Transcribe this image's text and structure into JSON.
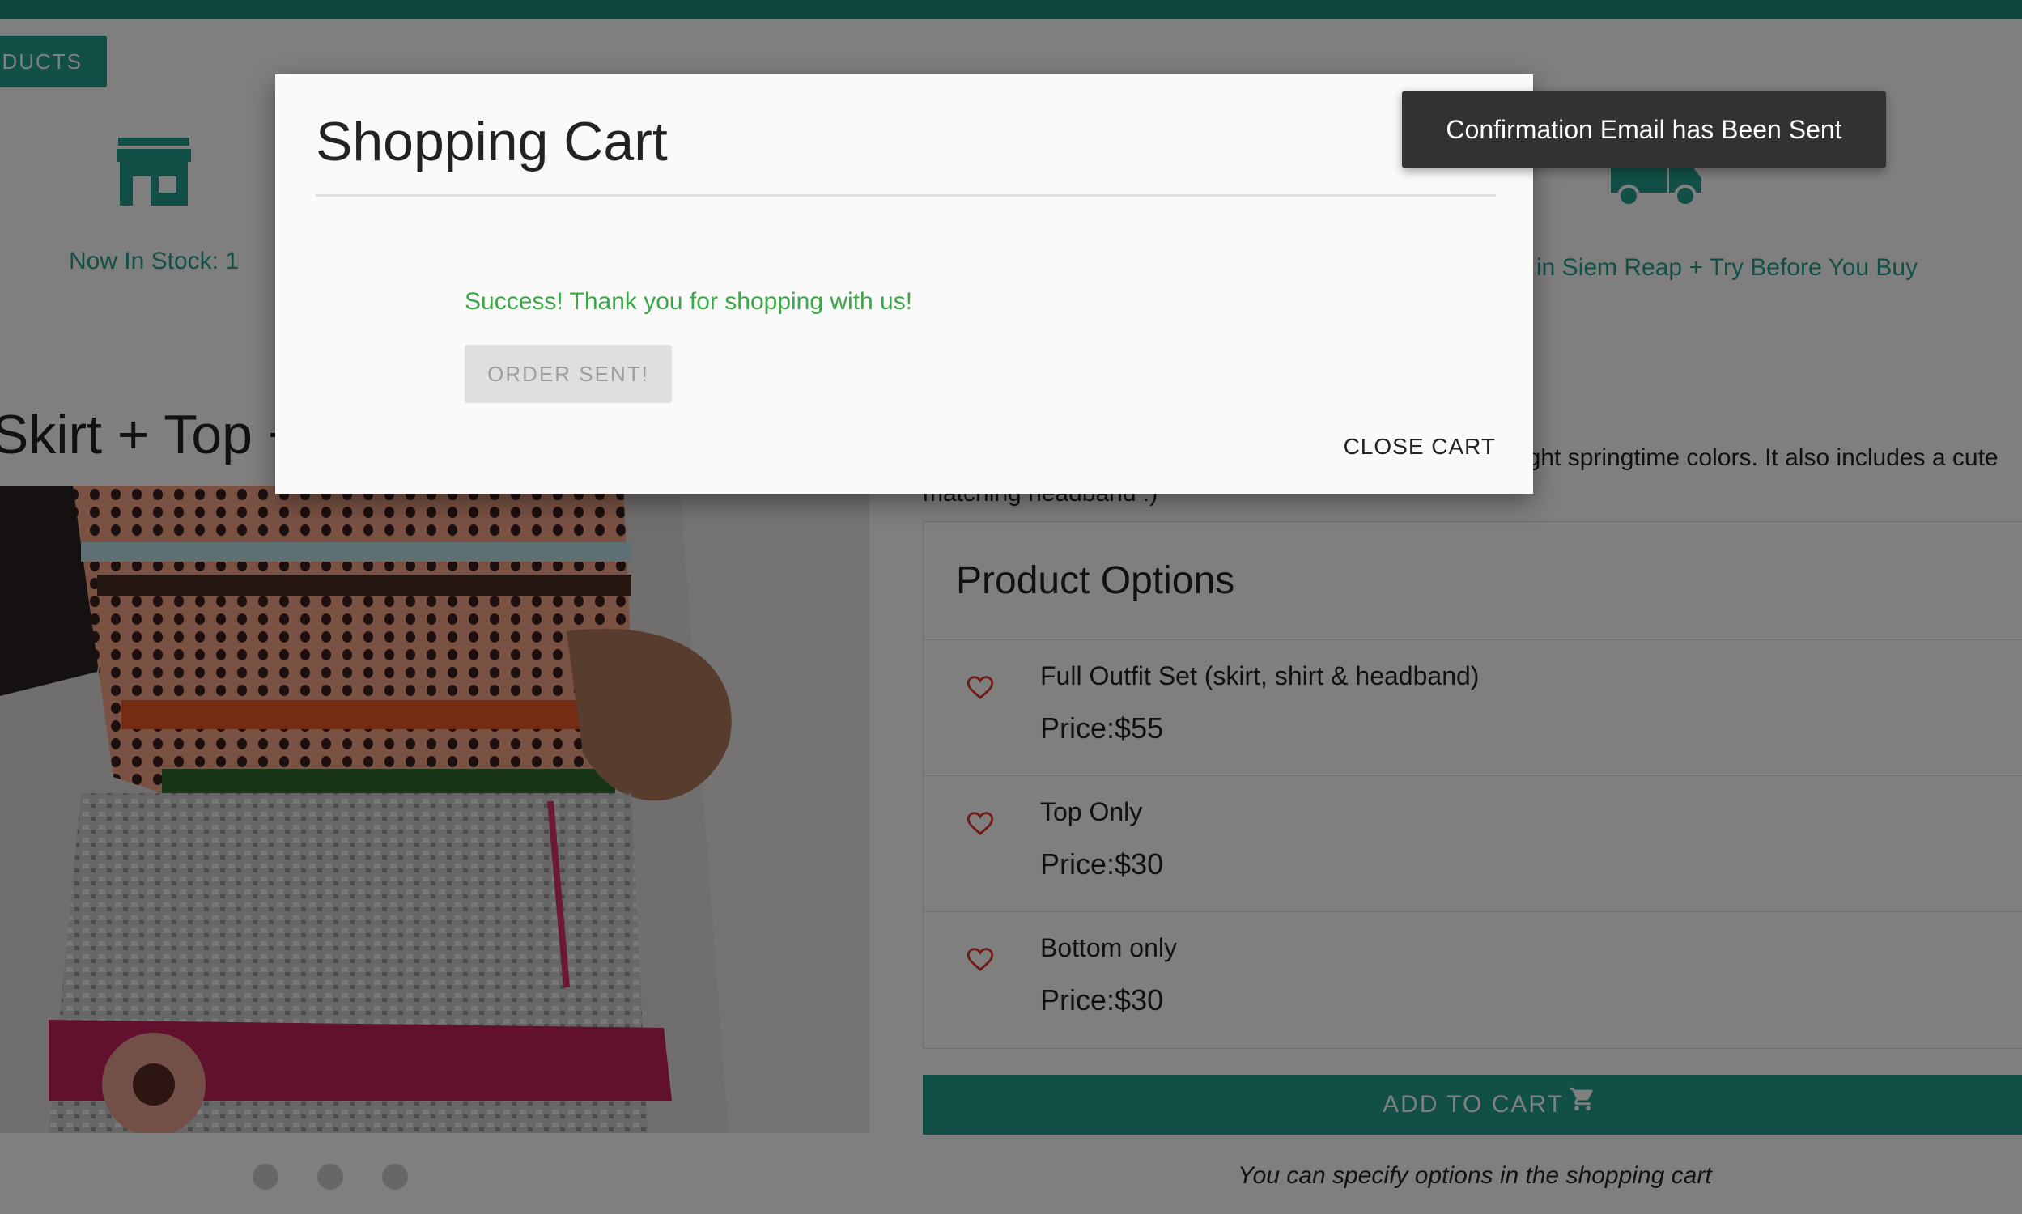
{
  "nav": {
    "products_label": "ODUCTS"
  },
  "features": {
    "stock_text": "Now In Stock: 1",
    "delivery_text": "in Siem Reap + Try Before You Buy"
  },
  "product": {
    "title": "Skirt + Top +",
    "description_line1": "ight springtime colors. It also includes a cute",
    "description_line2": "matching headband :)"
  },
  "options": {
    "title": "Product Options",
    "items": [
      {
        "name": "Full Outfit Set (skirt, shirt & headband)",
        "price": "Price:$55"
      },
      {
        "name": "Top Only",
        "price": "Price:$30"
      },
      {
        "name": "Bottom only",
        "price": "Price:$30"
      }
    ]
  },
  "add_to_cart_label": "ADD TO CART",
  "cart_note": "You can specify options in the shopping cart",
  "modal": {
    "title": "Shopping Cart",
    "success_message": "Success! Thank you for shopping with us!",
    "order_button_label": "ORDER SENT!",
    "close_label": "CLOSE CART"
  },
  "toast": {
    "message": "Confirmation Email has Been Sent"
  },
  "colors": {
    "accent": "#24a08f",
    "success": "#3aa846",
    "heart": "#e53935",
    "toast_bg": "#323232"
  },
  "icons": [
    "store-icon",
    "truck-icon",
    "heart-outline-icon",
    "cart-icon"
  ]
}
